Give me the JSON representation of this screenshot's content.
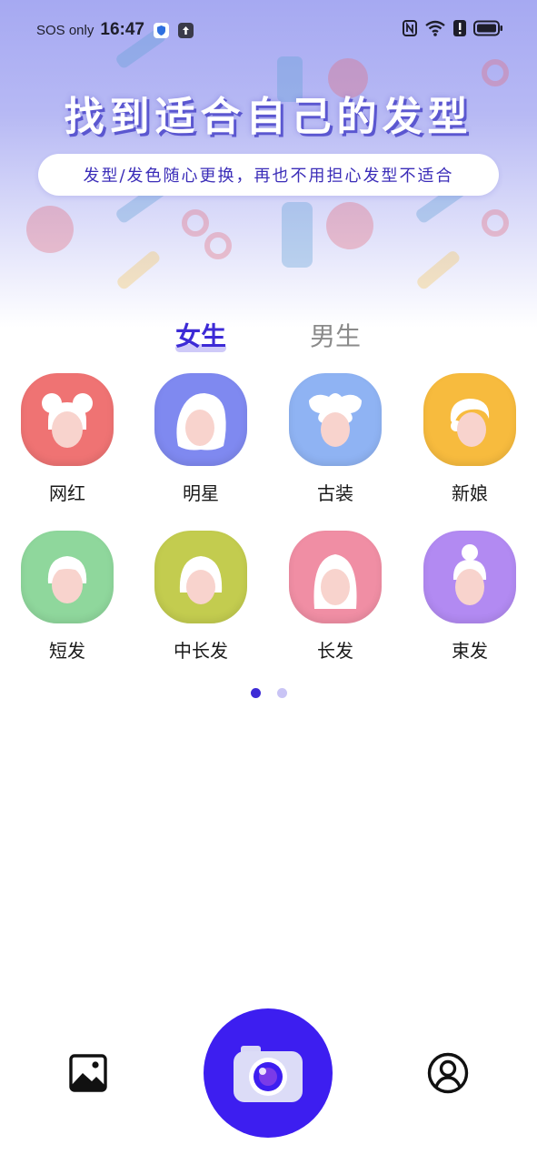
{
  "status_bar": {
    "carrier": "SOS only",
    "time": "16:47",
    "nfc_icon": "nfc-icon",
    "wifi_icon": "wifi-icon",
    "alert_icon": "alert-icon",
    "battery_icon": "battery-icon"
  },
  "hero": {
    "title": "找到适合自己的发型",
    "subtitle": "发型/发色随心更换，再也不用担心发型不适合"
  },
  "tabs": [
    {
      "label": "女生",
      "selected": true
    },
    {
      "label": "男生",
      "selected": false
    }
  ],
  "categories": [
    {
      "label": "网红",
      "icon": "buns-hair-icon",
      "color": "#ef7373"
    },
    {
      "label": "明星",
      "icon": "wavy-hair-icon",
      "color": "#7f89f0"
    },
    {
      "label": "古装",
      "icon": "ancient-hair-icon",
      "color": "#8fb3f3"
    },
    {
      "label": "新娘",
      "icon": "bride-hair-icon",
      "color": "#f7bb3e"
    },
    {
      "label": "短发",
      "icon": "short-hair-icon",
      "color": "#8fd79c"
    },
    {
      "label": "中长发",
      "icon": "medium-hair-icon",
      "color": "#c3cc4f"
    },
    {
      "label": "长发",
      "icon": "long-hair-icon",
      "color": "#f08ea4"
    },
    {
      "label": "束发",
      "icon": "tied-hair-icon",
      "color": "#b28af2"
    }
  ],
  "pagination": {
    "current": 1,
    "total": 2
  },
  "bottom_nav": {
    "gallery_icon": "gallery-icon",
    "camera_icon": "camera-icon",
    "profile_icon": "profile-icon"
  },
  "colors": {
    "accent": "#3d2bd6",
    "camera_button": "#3d1ef0",
    "hero_gradient_top": "#a6a9f2"
  }
}
